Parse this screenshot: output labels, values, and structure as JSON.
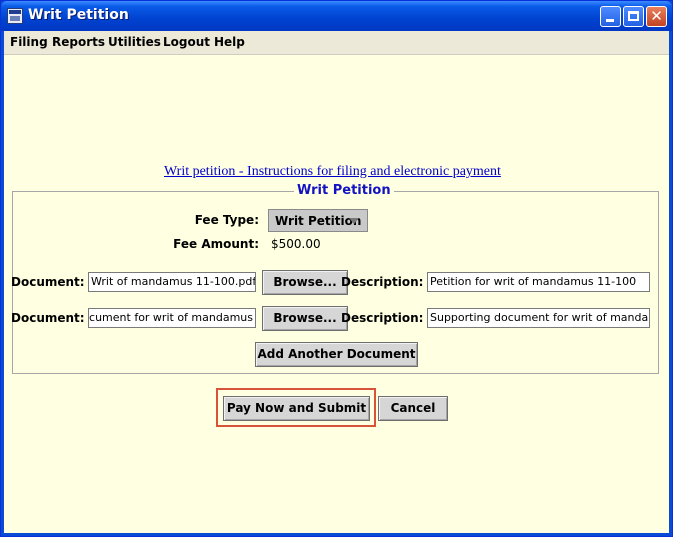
{
  "window": {
    "title": "Writ Petition"
  },
  "menu": {
    "items": [
      "Filing",
      "Reports",
      "Utilities",
      "Logout",
      "Help"
    ]
  },
  "instructions_link": "Writ petition - Instructions for filing and electronic payment ",
  "panel": {
    "title": "Writ Petition",
    "fee_type_label": "Fee Type:",
    "fee_type_value": "Writ Petition",
    "fee_amount_label": "Fee Amount:",
    "fee_amount_value": "$500.00",
    "documents": [
      {
        "label": "Document:",
        "file": "Writ of mandamus 11-100.pdf",
        "browse": "Browse...",
        "desc_label": "Description:",
        "description": "Petition for writ of mandamus 11-100"
      },
      {
        "label": "Document:",
        "file": "Supporting document for writ of mandamus",
        "browse": "Browse...",
        "desc_label": "Description:",
        "description": "Supporting document for writ of mandamus"
      }
    ],
    "add_document": "Add Another Document"
  },
  "actions": {
    "pay_submit": "Pay Now and Submit",
    "cancel": "Cancel"
  },
  "colors": {
    "content_bg": "#ffffe1",
    "title_text": "#1212c4",
    "link": "#0000cc",
    "highlight": "#d9533b"
  }
}
